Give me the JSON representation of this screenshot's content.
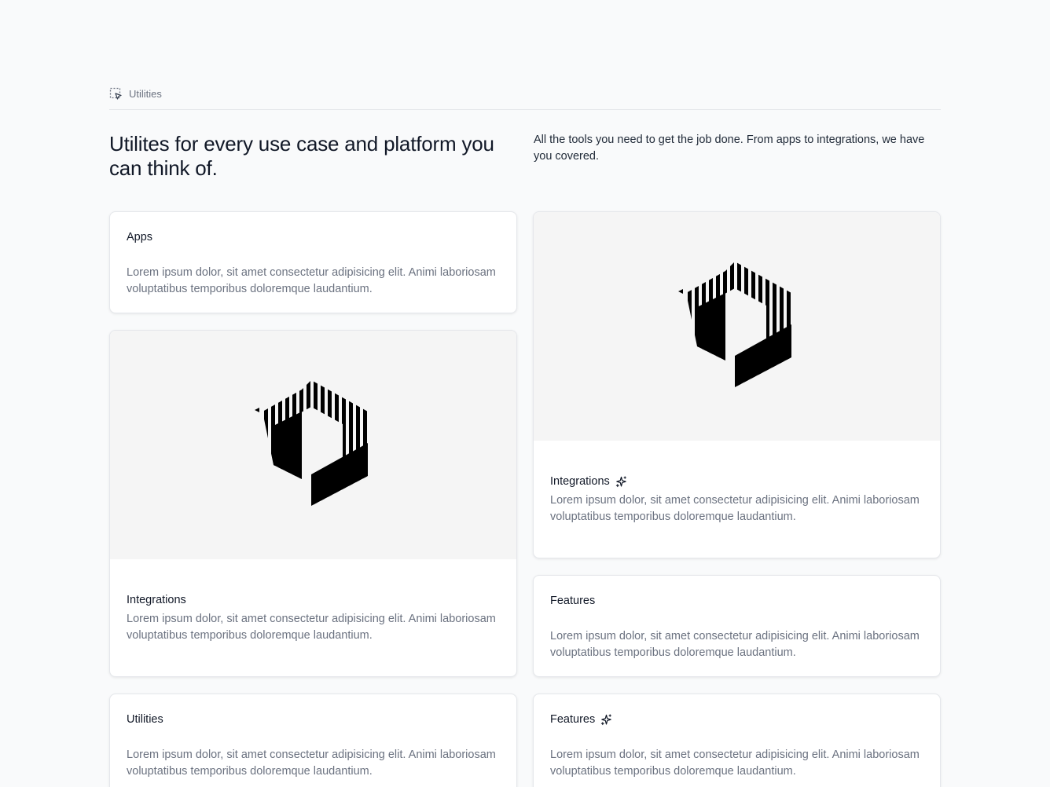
{
  "section": {
    "eyebrow_label": "Utilities",
    "eyebrow_icon": "cursor-select-icon",
    "headline": "Utilites for every use case and platform you can think of.",
    "subcopy": "All the tools you need to get the job done. From apps to integrations, we have you covered."
  },
  "cards": [
    {
      "title": "Apps",
      "description": "Lorem ipsum dolor, sit amet consectetur adipisicing elit. Animi laboriosam voluptatibus temporibus doloremque laudantium."
    },
    {
      "title": "Integrations",
      "icon": "sparkle-icon",
      "description": "Lorem ipsum dolor, sit amet consectetur adipisicing elit. Animi laboriosam voluptatibus temporibus doloremque laudantium."
    },
    {
      "title": "Integrations",
      "description": "Lorem ipsum dolor, sit amet consectetur adipisicing elit. Animi laboriosam voluptatibus temporibus doloremque laudantium."
    },
    {
      "title": "Features",
      "description": "Lorem ipsum dolor, sit amet consectetur adipisicing elit. Animi laboriosam voluptatibus temporibus doloremque laudantium."
    },
    {
      "title": "Utilities",
      "description": "Lorem ipsum dolor, sit amet consectetur adipisicing elit. Animi laboriosam voluptatibus temporibus doloremque laudantium."
    },
    {
      "title": "Features",
      "icon": "sparkle-icon",
      "description": "Lorem ipsum dolor, sit amet consectetur adipisicing elit. Animi laboriosam voluptatibus temporibus doloremque laudantium."
    }
  ],
  "colors": {
    "page_background": "#f9fafb",
    "card_background": "#ffffff",
    "media_background": "#f5f5f5",
    "text_primary": "#111827",
    "text_muted": "#6b7280"
  }
}
